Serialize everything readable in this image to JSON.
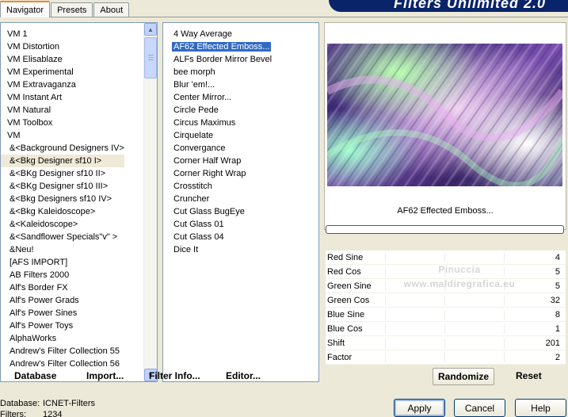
{
  "tabs": [
    "Navigator",
    "Presets",
    "About"
  ],
  "banner": "Filters Unlimited 2.0",
  "categories": [
    "VM 1",
    "VM Distortion",
    "VM Elisablaze",
    "VM Experimental",
    "VM Extravaganza",
    "VM Instant Art",
    "VM Natural",
    "VM Toolbox",
    "VM",
    "&<Background Designers IV>",
    "&<Bkg Designer sf10 I>",
    "&<BKg Designer sf10 II>",
    "&<BKg Designer sf10 III>",
    "&<Bkg Designers sf10 IV>",
    "&<Bkg Kaleidoscope>",
    "&<Kaleidoscope>",
    "&<Sandflower Specials\"v\" >",
    "&Neu!",
    "[AFS IMPORT]",
    "AB Filters 2000",
    "Alf's Border FX",
    "Alf's Power Grads",
    "Alf's Power Sines",
    "Alf's Power Toys",
    "AlphaWorks",
    "Andrew's Filter Collection 55",
    "Andrew's Filter Collection 56"
  ],
  "selected_category": "&<Bkg Designer sf10 I>",
  "filters": [
    "4 Way Average",
    "AF62 Effected Emboss...",
    "ALFs Border Mirror Bevel",
    "bee morph",
    "Blur 'em!...",
    "Center Mirror...",
    "Circle Pede",
    "Circus Maximus",
    "Cirquelate",
    "Convergance",
    "Corner Half Wrap",
    "Corner Right Wrap",
    "Crosstitch",
    "Cruncher",
    "Cut Glass  BugEye",
    "Cut Glass 01",
    "Cut Glass 04",
    "Dice It"
  ],
  "selected_filter": "AF62 Effected Emboss...",
  "preview_filter_name": "AF62 Effected Emboss...",
  "progress_fraction": 0,
  "params": [
    {
      "label": "Red Sine",
      "value": "4"
    },
    {
      "label": "Red Cos",
      "value": "5"
    },
    {
      "label": "Green Sine",
      "value": "5"
    },
    {
      "label": "Green Cos",
      "value": "32"
    },
    {
      "label": "Blue Sine",
      "value": "8"
    },
    {
      "label": "Blue Cos",
      "value": "1"
    },
    {
      "label": "Shift",
      "value": "201"
    },
    {
      "label": "Factor",
      "value": "2"
    }
  ],
  "watermark": [
    "Pinuccia",
    "www.maldiregrafica.eu"
  ],
  "buttons": {
    "database": "Database",
    "import": "Import...",
    "filter_info": "Filter Info...",
    "editor": "Editor...",
    "randomize": "Randomize",
    "reset": "Reset",
    "apply": "Apply",
    "cancel": "Cancel",
    "help": "Help"
  },
  "status": {
    "database_label": "Database:",
    "database_value": "ICNET-Filters",
    "filters_label": "Filters:",
    "filters_value": "1234"
  },
  "colors": {
    "selection": "#316ac5",
    "banner": "#0a246a",
    "tab_accent": "#e68b2c"
  },
  "icons": [
    "scroll-up-arrow-icon",
    "scroll-down-arrow-icon"
  ]
}
